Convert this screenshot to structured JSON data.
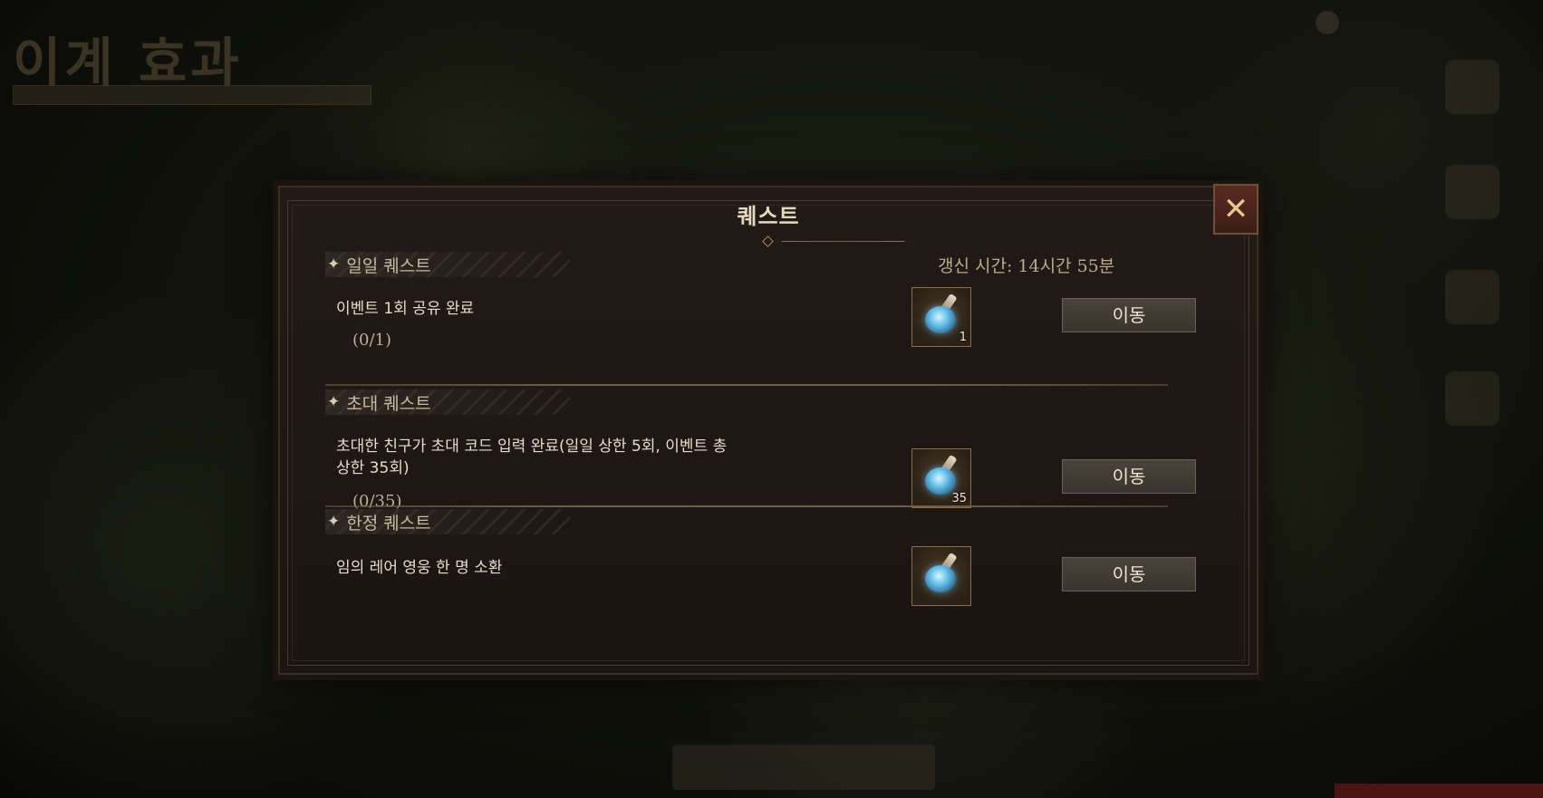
{
  "background": {
    "title": "이계 효과"
  },
  "dialog": {
    "title": "퀘스트",
    "close_icon": "close-icon",
    "refresh_time": "갱신 시간: 14시간 55분",
    "sections": [
      {
        "label": "일일 퀘스트",
        "quests": [
          {
            "text": "이벤트 1회 공유 완료",
            "progress": "(0/1)",
            "reward_icon": "crystal-rune-icon",
            "reward_count": "1",
            "button": "이동"
          }
        ]
      },
      {
        "label": "초대 퀘스트",
        "quests": [
          {
            "text": "초대한 친구가 초대 코드 입력 완료(일일 상한 5회, 이벤트 총 상한 35회)",
            "progress": "(0/35)",
            "reward_icon": "crystal-rune-icon",
            "reward_count": "35",
            "button": "이동"
          }
        ]
      },
      {
        "label": "한정 퀘스트",
        "quests": [
          {
            "text": "임의 레어 영웅 한 명 소환",
            "progress": "",
            "reward_icon": "crystal-rune-icon",
            "reward_count": "",
            "button": "이동"
          }
        ]
      }
    ]
  },
  "colors": {
    "accent": "#8b6d45",
    "text": "#e7dccb",
    "close": "#5a2b22"
  }
}
